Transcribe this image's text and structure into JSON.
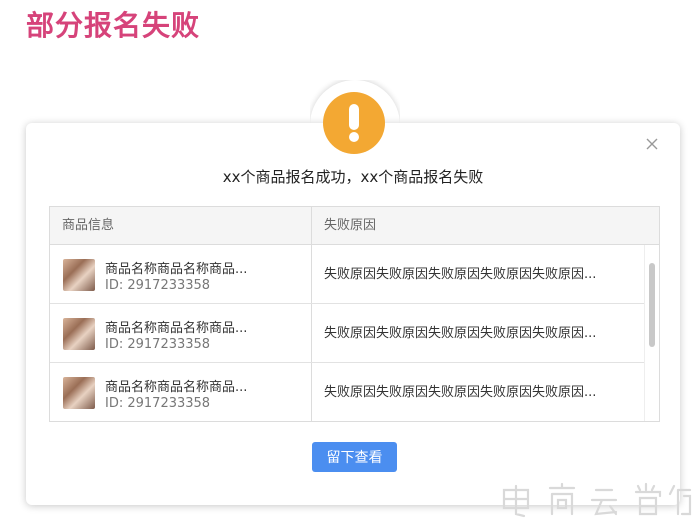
{
  "page": {
    "heading": "部分报名失败"
  },
  "dialog": {
    "title": "xx个商品报名成功，xx个商品报名失败",
    "icon": "warning-exclamation-icon",
    "close_icon": "close-icon",
    "table": {
      "columns": [
        "商品信息",
        "失败原因"
      ],
      "rows": [
        {
          "name": "商品名称商品名称商品...",
          "id": "ID: 2917233358",
          "reason": "失败原因失败原因失败原因失败原因失败原因..."
        },
        {
          "name": "商品名称商品名称商品...",
          "id": "ID: 2917233358",
          "reason": "失败原因失败原因失败原因失败原因失败原因..."
        },
        {
          "name": "商品名称商品名称商品...",
          "id": "ID: 2917233358",
          "reason": "失败原因失败原因失败原因失败原因失败原因..."
        }
      ]
    },
    "confirm_label": "留下查看"
  },
  "colors": {
    "heading": "#d6437a",
    "warning": "#f3a833",
    "primary": "#4b8ef0"
  }
}
